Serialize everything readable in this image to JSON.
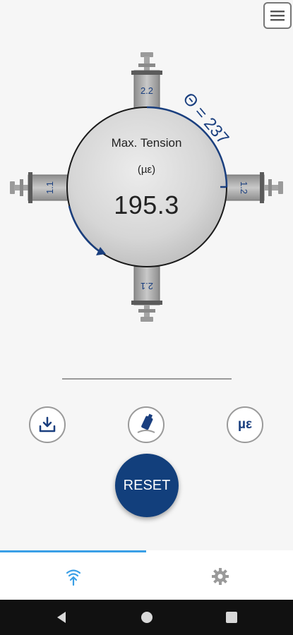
{
  "header": {
    "menu_icon": "hamburger-menu-icon"
  },
  "gauge": {
    "title": "Max. Tension",
    "unit": "(µε)",
    "value": "195.3",
    "angle_label": "Θ = 237",
    "sensors": [
      "2.2",
      "1.2",
      "2.1",
      "1.1"
    ]
  },
  "actions": {
    "download_icon": "download-icon",
    "mount_icon": "bolt-mount-icon",
    "unit_label": "µε"
  },
  "reset": {
    "label": "RESET"
  },
  "tabs": [
    {
      "icon": "wireless-signal-icon",
      "active": true
    },
    {
      "icon": "gear-icon",
      "active": false
    }
  ],
  "colors": {
    "primary": "#123f7c",
    "accent": "#3a9fe6"
  }
}
